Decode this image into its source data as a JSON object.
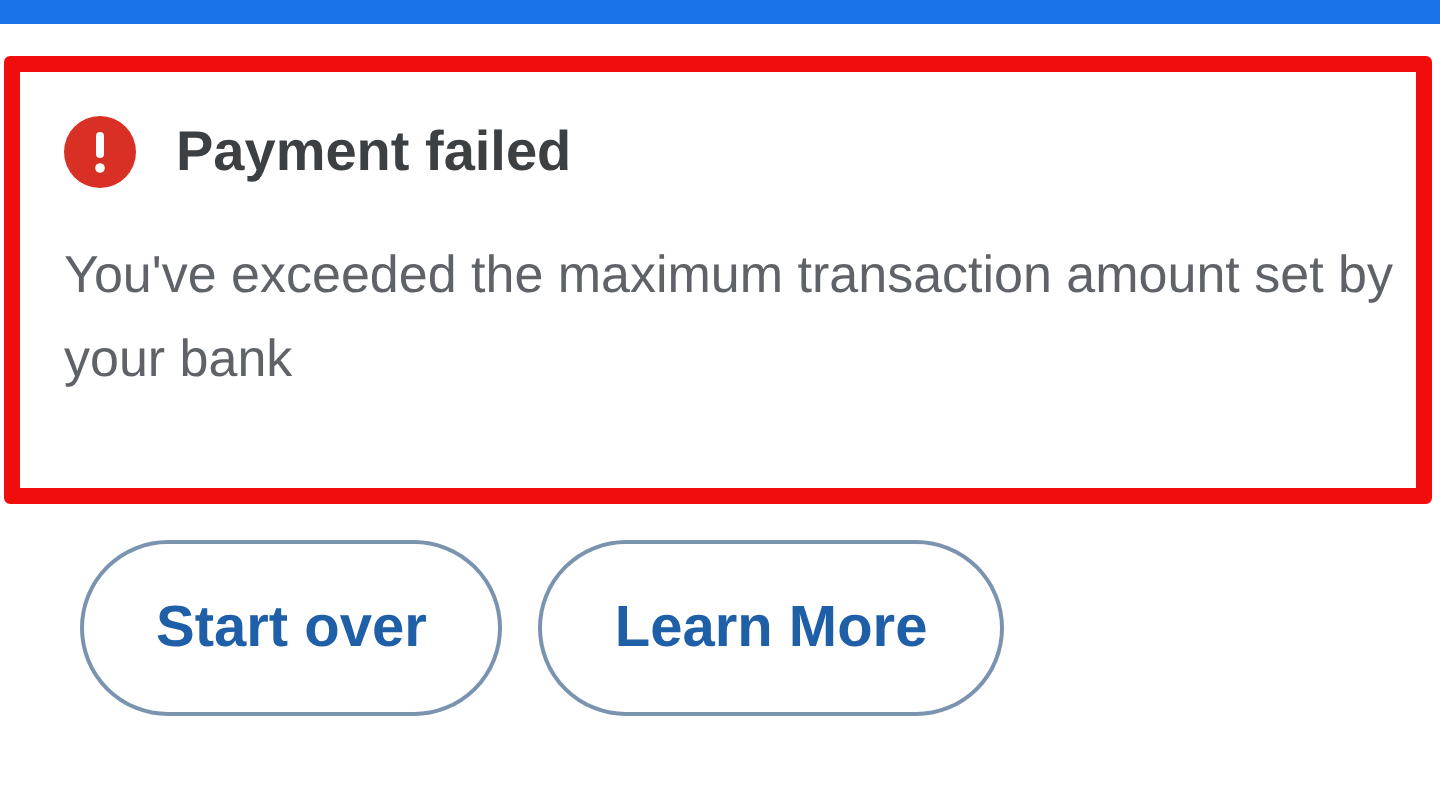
{
  "alert": {
    "title": "Payment failed",
    "message": "You've exceeded the maximum transaction amount set by your bank"
  },
  "buttons": [
    "Start over",
    "Learn More"
  ]
}
